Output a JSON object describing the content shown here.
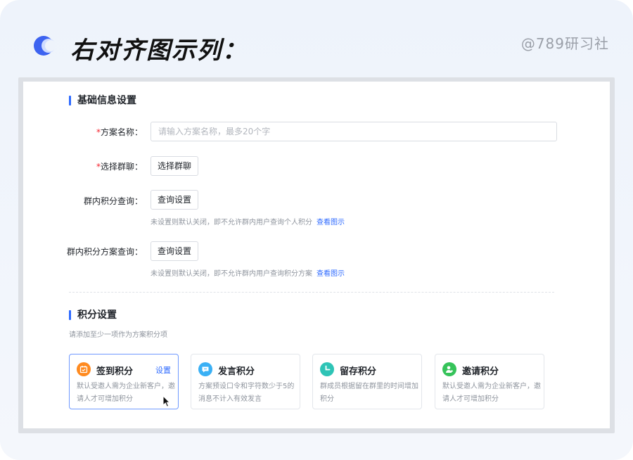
{
  "header": {
    "title": "右对齐图示列：",
    "watermark": "@789研习社"
  },
  "basic_section": {
    "title": "基础信息设置",
    "fields": {
      "plan_name": {
        "required_mark": "*",
        "label": "方案名称：",
        "placeholder": "请输入方案名称，最多20个字"
      },
      "group_chat": {
        "required_mark": "*",
        "label": "选择群聊：",
        "button": "选择群聊"
      },
      "group_points_query": {
        "label": "群内积分查询：",
        "button": "查询设置",
        "hint": "未设置则默认关闭，即不允许群内用户查询个人积分",
        "link": "查看图示"
      },
      "group_plan_query": {
        "label": "群内积分方案查询：",
        "button": "查询设置",
        "hint": "未设置则默认关闭，即不允许群内用户查询积分方案",
        "link": "查看图示"
      }
    }
  },
  "points_section": {
    "title": "积分设置",
    "hint": "请添加至少一项作为方案积分项",
    "options": [
      {
        "title": "签到积分",
        "action": "设置",
        "desc": "默认受邀人需为企业新客户，邀请人才可增加积分",
        "icon": "calendar-check-icon",
        "color": "#ff8a1f",
        "active": true
      },
      {
        "title": "发言积分",
        "action": "",
        "desc": "方案预设口令和字符数少于5的消息不计入有效发言",
        "icon": "chat-bubble-icon",
        "color": "#3ab0f5",
        "active": false
      },
      {
        "title": "留存积分",
        "action": "",
        "desc": "群成员根据留在群里的时间增加积分",
        "icon": "clock-icon",
        "color": "#2ec4b6",
        "active": false
      },
      {
        "title": "邀请积分",
        "action": "",
        "desc": "默认受邀人需为企业新客户，邀请人才可增加积分",
        "icon": "user-add-icon",
        "color": "#36c35a",
        "active": false
      }
    ]
  },
  "colors": {
    "accent": "#2f6bff",
    "required": "#f5222d"
  }
}
